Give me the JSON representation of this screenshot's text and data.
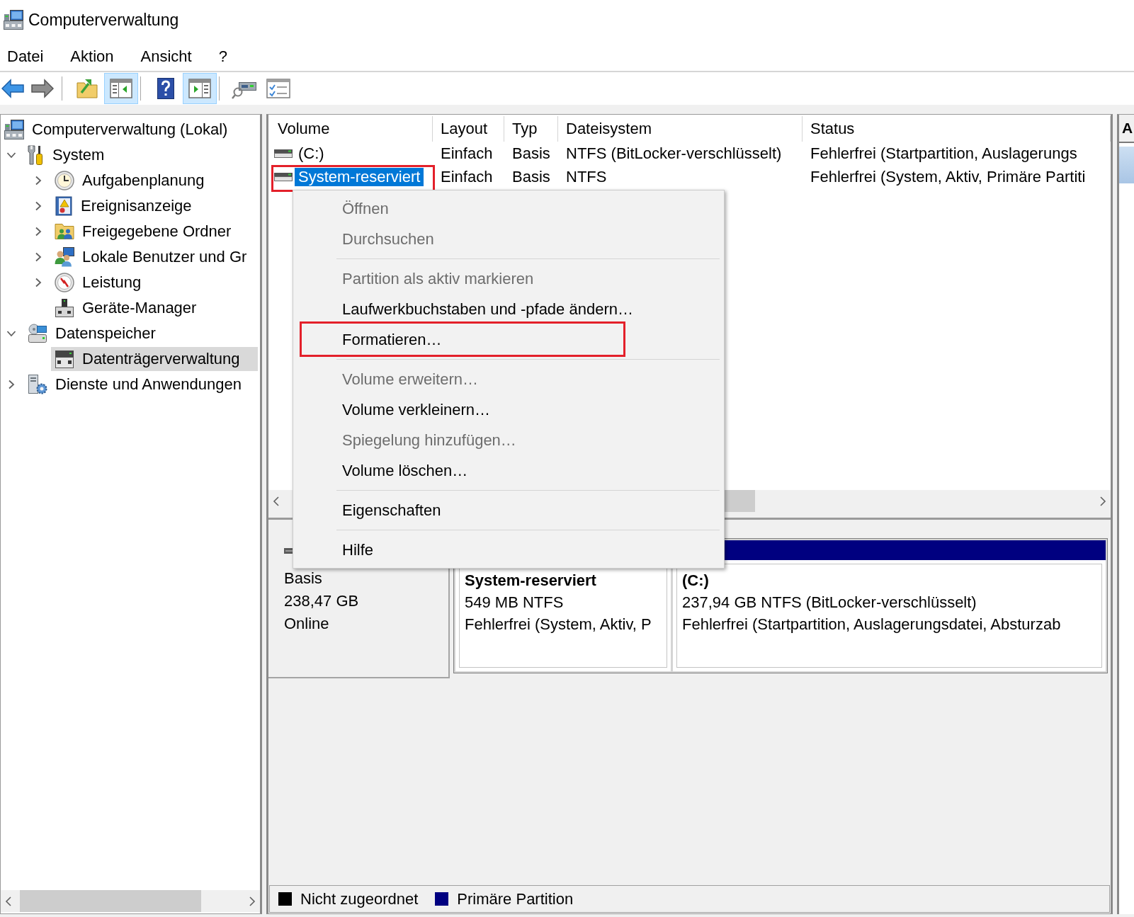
{
  "window": {
    "title": "Computerverwaltung"
  },
  "menu_bar": [
    {
      "label": "Datei"
    },
    {
      "label": "Aktion"
    },
    {
      "label": "Ansicht"
    },
    {
      "label": "?"
    }
  ],
  "toolbar": [
    {
      "kind": "back",
      "on": false
    },
    {
      "kind": "forward",
      "on": false
    },
    {
      "kind": "separator"
    },
    {
      "kind": "folder-up",
      "on": false
    },
    {
      "kind": "tree-pane",
      "on": true
    },
    {
      "kind": "separator"
    },
    {
      "kind": "help",
      "on": false
    },
    {
      "kind": "action-pane",
      "on": true
    },
    {
      "kind": "separator"
    },
    {
      "kind": "connect",
      "on": false
    },
    {
      "kind": "properties",
      "on": false
    }
  ],
  "tree": {
    "items": [
      {
        "label": "Computerverwaltung (Lokal)",
        "kind": "computer",
        "expandable": false,
        "selected": false,
        "children": [
          {
            "label": "System",
            "kind": "tools",
            "expandable": true,
            "expanded": true,
            "selected": false,
            "children": [
              {
                "label": "Aufgabenplanung",
                "kind": "clock",
                "expandable": true,
                "expanded": false,
                "selected": false
              },
              {
                "label": "Ereignisanzeige",
                "kind": "event-log",
                "expandable": true,
                "expanded": false,
                "selected": false
              },
              {
                "label": "Freigegebene Ordner",
                "kind": "shared-folder",
                "expandable": true,
                "expanded": false,
                "selected": false
              },
              {
                "label": "Lokale Benutzer und Gr",
                "kind": "users",
                "expandable": true,
                "expanded": false,
                "selected": false
              },
              {
                "label": "Leistung",
                "kind": "performance",
                "expandable": true,
                "expanded": false,
                "selected": false
              },
              {
                "label": "Geräte-Manager",
                "kind": "device",
                "expandable": false,
                "selected": false
              }
            ]
          },
          {
            "label": "Datenspeicher",
            "kind": "storage",
            "expandable": true,
            "expanded": true,
            "selected": false,
            "children": [
              {
                "label": "Datenträgerverwaltung",
                "kind": "disk",
                "expandable": false,
                "selected": true
              }
            ]
          },
          {
            "label": "Dienste und Anwendungen",
            "kind": "services",
            "expandable": true,
            "expanded": false,
            "selected": false
          }
        ]
      }
    ]
  },
  "volume_table": {
    "columns": [
      "Volume",
      "Layout",
      "Typ",
      "Dateisystem",
      "Status"
    ],
    "rows": [
      {
        "cells": [
          "(C:)",
          "Einfach",
          "Basis",
          "NTFS (BitLocker-verschlüsselt)",
          "Fehlerfrei (Startpartition, Auslagerungs"
        ],
        "selected": false,
        "annotated": false
      },
      {
        "cells": [
          "System-reserviert",
          "Einfach",
          "Basis",
          "NTFS",
          "Fehlerfrei (System, Aktiv, Primäre Partiti"
        ],
        "selected": true,
        "annotated": true
      }
    ]
  },
  "actions_pane": {
    "title": "A"
  },
  "context_menu": {
    "items": [
      {
        "kind": "item",
        "label": "Öffnen",
        "disabled": true,
        "annotated": false
      },
      {
        "kind": "item",
        "label": "Durchsuchen",
        "disabled": true,
        "annotated": false
      },
      {
        "kind": "separator"
      },
      {
        "kind": "item",
        "label": "Partition als aktiv markieren",
        "disabled": true,
        "annotated": false
      },
      {
        "kind": "item",
        "label": "Laufwerkbuchstaben und -pfade ändern…",
        "disabled": false,
        "annotated": false
      },
      {
        "kind": "item",
        "label": "Formatieren…",
        "disabled": false,
        "annotated": true
      },
      {
        "kind": "separator"
      },
      {
        "kind": "item",
        "label": "Volume erweitern…",
        "disabled": true,
        "annotated": false
      },
      {
        "kind": "item",
        "label": "Volume verkleinern…",
        "disabled": false,
        "annotated": false
      },
      {
        "kind": "item",
        "label": "Spiegelung hinzufügen…",
        "disabled": true,
        "annotated": false
      },
      {
        "kind": "item",
        "label": "Volume löschen…",
        "disabled": false,
        "annotated": false
      },
      {
        "kind": "separator"
      },
      {
        "kind": "item",
        "label": "Eigenschaften",
        "disabled": false,
        "annotated": false
      },
      {
        "kind": "separator"
      },
      {
        "kind": "item",
        "label": "Hilfe",
        "disabled": false,
        "annotated": false
      }
    ]
  },
  "disk": {
    "info": [
      "Basis",
      "238,47 GB",
      "Online"
    ],
    "partitions": [
      {
        "kind": "primary",
        "name": "System-reserviert",
        "size": "549 MB NTFS",
        "status": "Fehlerfrei (System, Aktiv, P"
      },
      {
        "kind": "primary",
        "name": "(C:)",
        "size": "237,94 GB NTFS (BitLocker-verschlüsselt)",
        "status": "Fehlerfrei (Startpartition, Auslagerungsdatei, Absturzab"
      }
    ]
  },
  "legend": [
    {
      "label": "Nicht zugeordnet",
      "color": "#000000"
    },
    {
      "label": "Primäre Partition",
      "color": "#000080"
    }
  ]
}
